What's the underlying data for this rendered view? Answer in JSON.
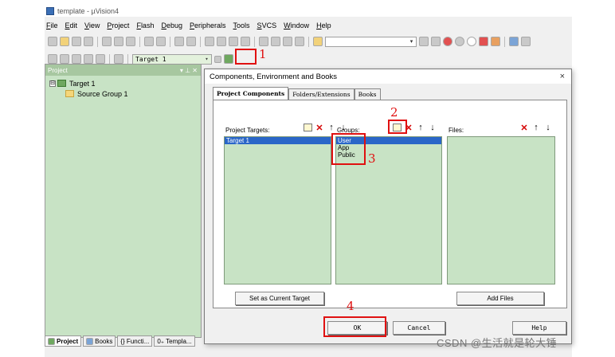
{
  "window": {
    "title": "template - µVision4"
  },
  "menu": [
    "File",
    "Edit",
    "View",
    "Project",
    "Flash",
    "Debug",
    "Peripherals",
    "Tools",
    "SVCS",
    "Window",
    "Help"
  ],
  "toolbar": {
    "target_select": "Target 1"
  },
  "project_panel": {
    "header": "Project",
    "header_controls": "▾ ⊥ ✕",
    "tree": {
      "root_box": "⊟",
      "root": "Target 1",
      "group": "Source Group 1"
    },
    "tabs": [
      "Project",
      "Books",
      "{} Functi...",
      "0₊ Templa..."
    ]
  },
  "dialog": {
    "title": "Components, Environment and Books",
    "close": "×",
    "tabs": [
      "Project Components",
      "Folders/Extensions",
      "Books"
    ],
    "targets": {
      "label": "Project Targets:",
      "items": [
        "Target 1"
      ]
    },
    "groups": {
      "label": "Groups:",
      "items": [
        "User",
        "App",
        "Public"
      ]
    },
    "files": {
      "label": "Files:",
      "items": []
    },
    "set_current_target": "Set as Current Target",
    "add_files": "Add Files",
    "ok": "OK",
    "cancel": "Cancel",
    "help": "Help"
  },
  "annotations": [
    "1",
    "2",
    "3",
    "4"
  ],
  "watermark": "CSDN @生活就是轮大锤"
}
